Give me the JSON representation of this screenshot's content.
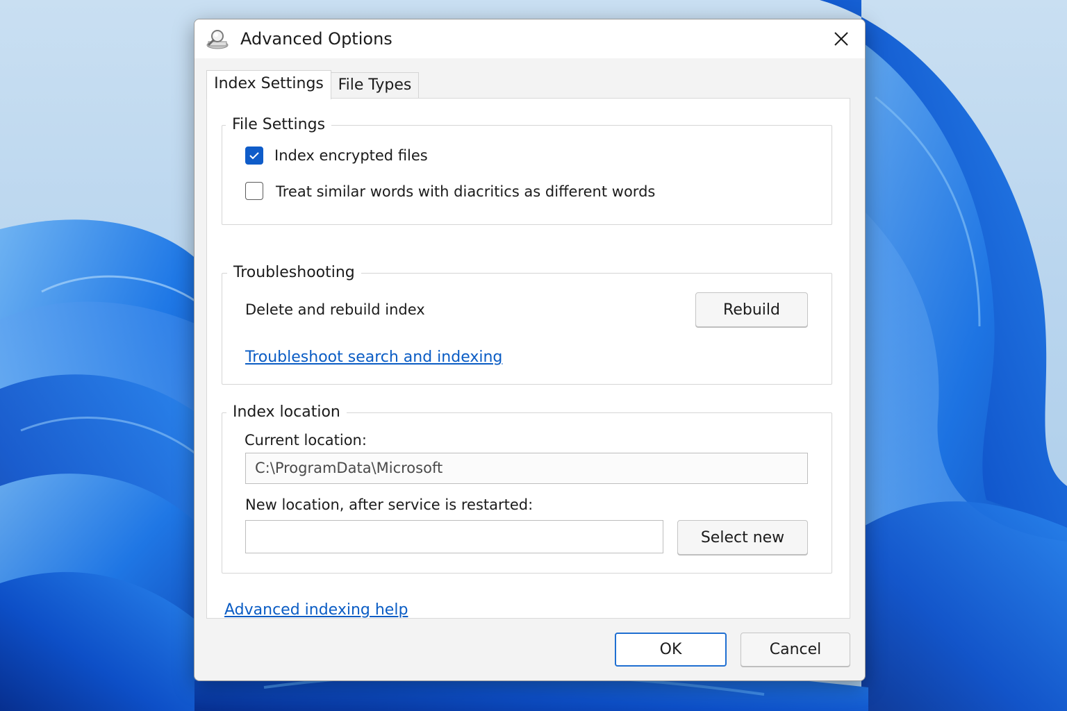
{
  "window": {
    "title": "Advanced Options",
    "icon": "indexing-options-icon",
    "close_icon": "close-icon"
  },
  "tabs": [
    {
      "label": "Index Settings",
      "selected": true
    },
    {
      "label": "File Types",
      "selected": false
    }
  ],
  "file_settings": {
    "title": "File Settings",
    "options": [
      {
        "label": "Index encrypted files",
        "checked": true
      },
      {
        "label": "Treat similar words with diacritics as different words",
        "checked": false
      }
    ]
  },
  "troubleshooting": {
    "title": "Troubleshooting",
    "rebuild_label": "Delete and rebuild index",
    "rebuild_button": "Rebuild",
    "troubleshoot_link": "Troubleshoot search and indexing"
  },
  "index_location": {
    "title": "Index location",
    "current_label": "Current location:",
    "current_value": "C:\\ProgramData\\Microsoft",
    "new_label": "New location, after service is restarted:",
    "new_value": "",
    "select_button": "Select new"
  },
  "help_link": "Advanced indexing help",
  "footer": {
    "ok": "OK",
    "cancel": "Cancel"
  },
  "colors": {
    "accent": "#0f5cc9",
    "link": "#0a5cc4",
    "wallpaper_blue": "#1a6fe0"
  }
}
